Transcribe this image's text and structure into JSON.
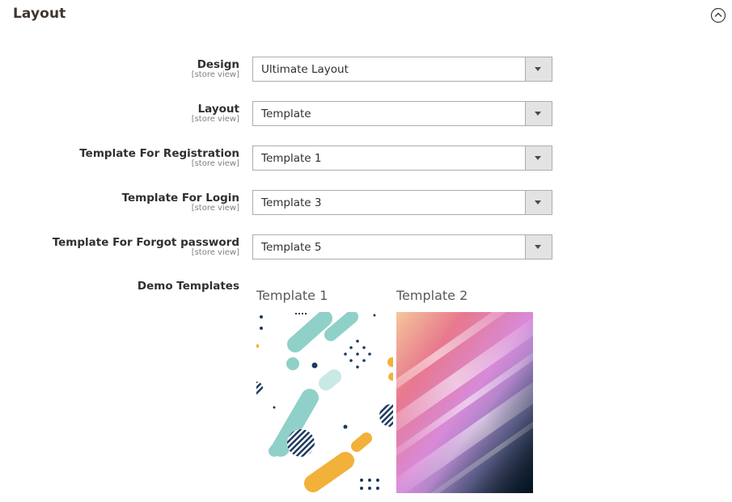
{
  "section": {
    "title": "Layout",
    "collapse_icon": "chevron-up-circle-icon"
  },
  "fields": [
    {
      "label": "Design",
      "scope": "[store view]",
      "value": "Ultimate Layout"
    },
    {
      "label": "Layout",
      "scope": "[store view]",
      "value": "Template"
    },
    {
      "label": "Template For Registration",
      "scope": "[store view]",
      "value": "Template 1"
    },
    {
      "label": "Template For Login",
      "scope": "[store view]",
      "value": "Template 3"
    },
    {
      "label": "Template For Forgot password",
      "scope": "[store view]",
      "value": "Template 5"
    }
  ],
  "demo": {
    "label": "Demo Templates",
    "templates": [
      {
        "title": "Template 1"
      },
      {
        "title": "Template 2"
      }
    ]
  },
  "colors": {
    "select_button_bg": "#e3e3e3",
    "select_border": "#adadad",
    "teal_shape": "#8fd0c8",
    "navy_dot": "#1d3a5f",
    "orange_shape": "#f2b13a"
  }
}
